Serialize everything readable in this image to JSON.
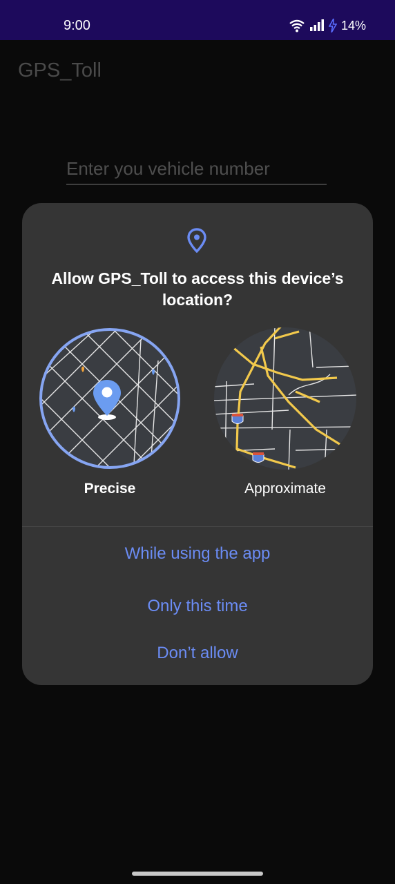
{
  "status_bar": {
    "time": "9:00",
    "battery_percent": "14%",
    "icons": [
      "wifi-icon",
      "signal-icon",
      "charging-bolt-icon"
    ]
  },
  "app": {
    "title": "GPS_Toll",
    "vehicle_input_placeholder": "Enter you vehicle number"
  },
  "dialog": {
    "icon": "location-pin-icon",
    "title": "Allow GPS_Toll to access this device’s location?",
    "options": [
      {
        "label": "Precise",
        "selected": true
      },
      {
        "label": "Approximate",
        "selected": false
      }
    ],
    "actions": {
      "while_using": "While using the app",
      "only_this_time": "Only this time",
      "dont_allow": "Don’t allow"
    }
  },
  "colors": {
    "status_bar_bg": "#1d0a5c",
    "dialog_bg": "#353535",
    "accent": "#6b8cf4",
    "map_road_yellow": "#f2c94c"
  }
}
